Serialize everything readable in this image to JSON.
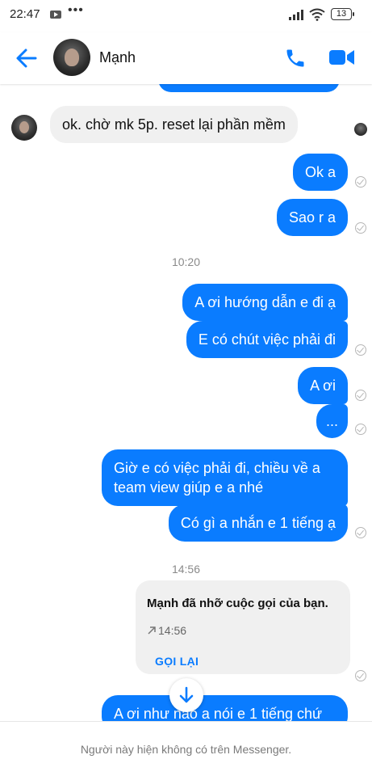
{
  "status_bar": {
    "time": "22:47",
    "dots": "•••",
    "battery": "13"
  },
  "header": {
    "contact_name": "Mạnh"
  },
  "colors": {
    "accent": "#0a7cff",
    "incoming_bubble": "#f0f0f0",
    "outgoing_text": "#ffffff"
  },
  "messages": [
    {
      "dir": "in",
      "text": "ok. chờ mk 5p. reset lại phần mềm"
    },
    {
      "dir": "out",
      "text": "Ok a"
    },
    {
      "dir": "out",
      "text": "Sao r a"
    },
    {
      "dir": "out",
      "text": "A ơi hướng dẫn e đi ạ"
    },
    {
      "dir": "out",
      "text": "E có chút việc phải đi"
    },
    {
      "dir": "out",
      "text": "A ơi"
    },
    {
      "dir": "out",
      "text": "..."
    },
    {
      "dir": "out",
      "text": "Giờ e có việc phải đi, chiều về a team view giúp e a nhé"
    },
    {
      "dir": "out",
      "text": "Có gì a nhắn e 1 tiếng ạ"
    },
    {
      "dir": "out",
      "text": "A ơi như nào a nói e 1 tiếng chứ"
    }
  ],
  "timestamps": {
    "t1": "10:20",
    "t2": "14:56"
  },
  "missed_call": {
    "title": "Mạnh đã nhỡ cuộc gọi của bạn.",
    "time": "14:56",
    "action": "GỌI LẠI"
  },
  "footer": {
    "notice": "Người này hiện không có trên Messenger."
  },
  "icons": [
    "back-arrow-icon",
    "phone-icon",
    "video-camera-icon",
    "chevron-down-icon",
    "delivered-check-icon"
  ]
}
